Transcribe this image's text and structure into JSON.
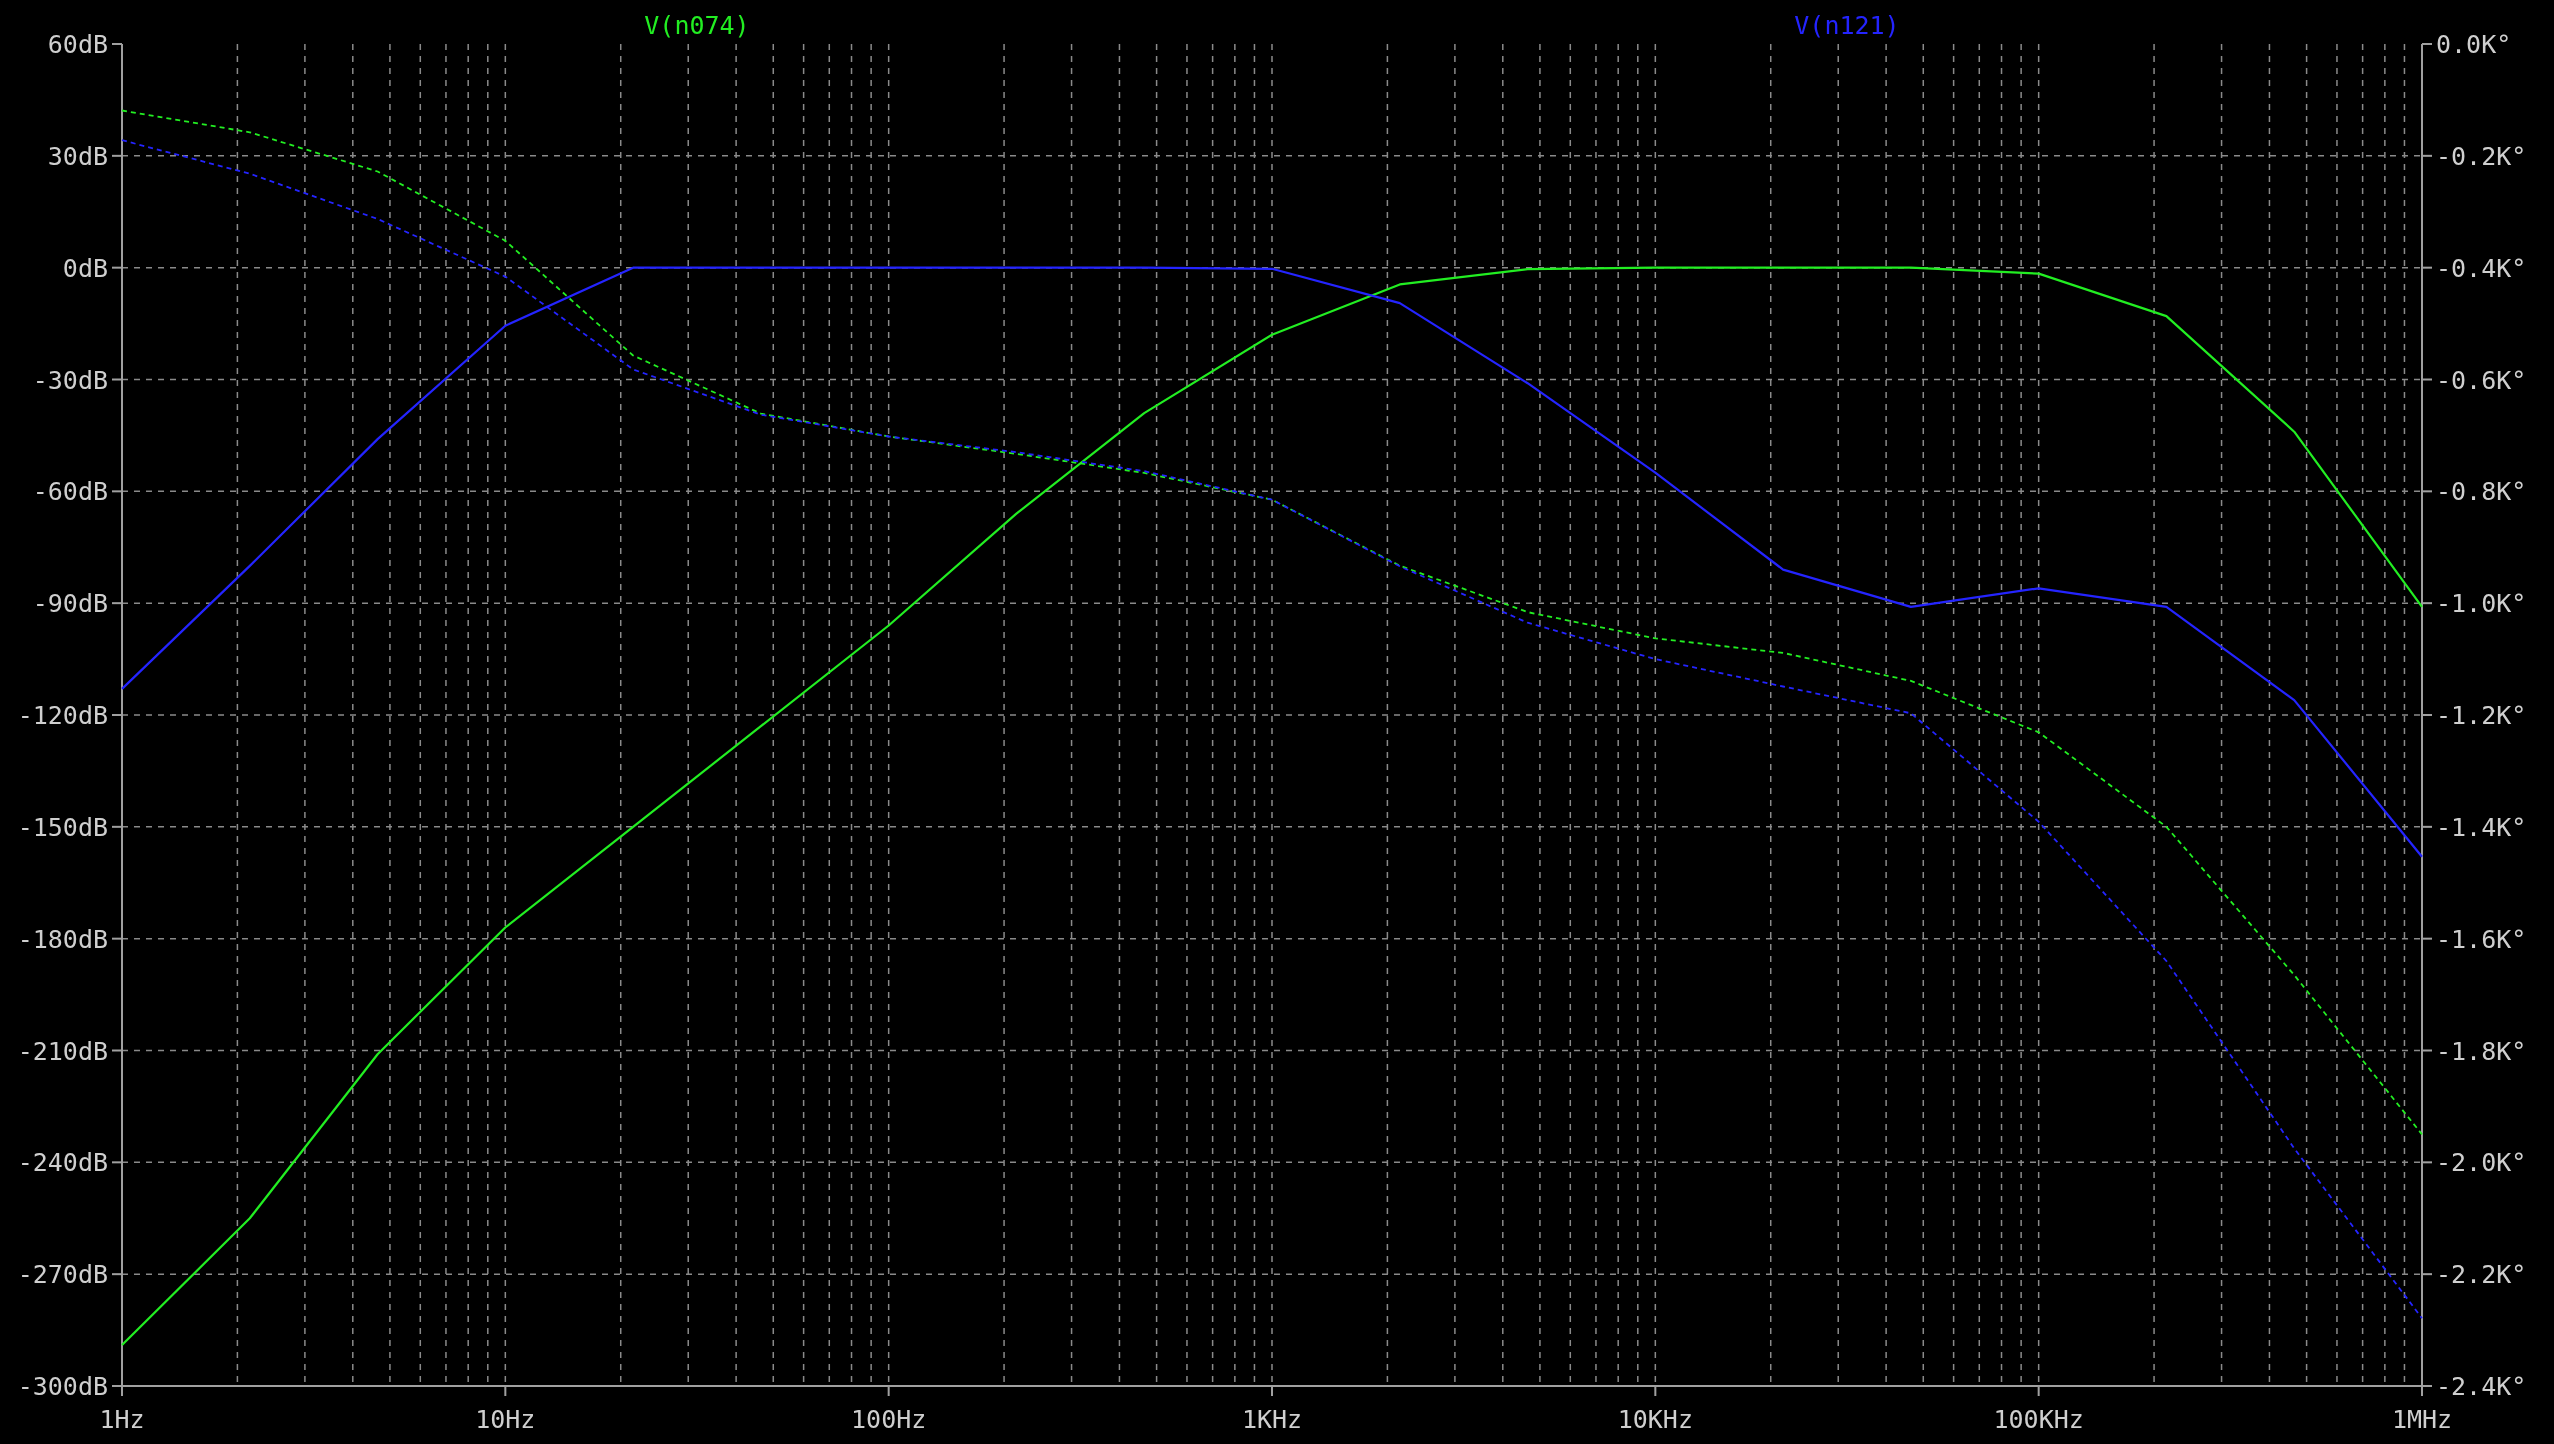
{
  "plot": {
    "magnitude_chart": {
      "chart_data": {
        "type": "line",
        "categories": [
          "1Hz",
          null,
          null,
          "10Hz",
          null,
          null,
          "100Hz",
          null,
          null,
          "1KHz",
          null,
          null,
          "10KHz",
          null,
          null,
          "100KHz",
          null,
          null,
          "1MHz"
        ],
        "series": [
          {
            "name": "V(n074)",
            "color": "#22ee22",
            "line_style": "solid",
            "values": [
              -289,
              -255,
              -211,
              -177,
              -150,
              -123,
              -96,
              -66,
              -39,
              -18,
              -4.5,
              -0.4,
              0,
              0,
              0,
              -1.6,
              -13,
              -44,
              -91
            ]
          },
          {
            "name": "V(n121)",
            "color": "#2424ff",
            "line_style": "solid",
            "values": [
              -113,
              -80,
              -46,
              -15.6,
              0,
              0,
              0,
              0,
              0,
              -0.3,
              -9.5,
              -31,
              -55,
              -81,
              -91,
              -86,
              -91,
              -116,
              -158
            ]
          }
        ],
        "ylim": [
          -300,
          60
        ],
        "grid": true,
        "yticks": [
          {
            "value": 60,
            "label": "60dB"
          },
          {
            "value": 30,
            "label": "30dB"
          },
          {
            "value": 0,
            "label": "0dB"
          },
          {
            "value": -30,
            "label": "-30dB"
          },
          {
            "value": -60,
            "label": "-60dB"
          },
          {
            "value": -90,
            "label": "-90dB"
          },
          {
            "value": -120,
            "label": "-120dB"
          },
          {
            "value": -150,
            "label": "-150dB"
          },
          {
            "value": -180,
            "label": "-180dB"
          },
          {
            "value": -210,
            "label": "-210dB"
          },
          {
            "value": -240,
            "label": "-240dB"
          },
          {
            "value": -270,
            "label": "-270dB"
          },
          {
            "value": -300,
            "label": "-300dB"
          }
        ]
      }
    },
    "phase_chart": {
      "chart_data": {
        "type": "line",
        "categories": [
          null,
          null,
          null,
          null,
          null,
          null,
          null,
          null,
          null,
          null,
          null,
          null,
          null,
          null,
          null,
          null,
          null,
          null,
          null
        ],
        "series": [
          {
            "color": "#22ee22",
            "line_style": "dashed",
            "values": [
              -0.119,
              -0.158,
              -0.228,
              -0.352,
              -0.557,
              -0.661,
              -0.702,
              -0.733,
              -0.767,
              -0.815,
              -0.933,
              -1.016,
              -1.063,
              -1.089,
              -1.139,
              -1.231,
              -1.4,
              -1.665,
              -1.95
            ]
          },
          {
            "color": "#2424ff",
            "line_style": "dashed",
            "values": [
              -0.172,
              -0.232,
              -0.313,
              -0.416,
              -0.582,
              -0.663,
              -0.702,
              -0.73,
              -0.764,
              -0.815,
              -0.934,
              -1.035,
              -1.1,
              -1.149,
              -1.197,
              -1.391,
              -1.64,
              -1.975,
              -2.279
            ]
          }
        ],
        "ylim": [
          -2.4,
          0
        ],
        "yticks": [
          {
            "value": 0,
            "label": "0.0K°"
          },
          {
            "value": -0.2,
            "label": "-0.2K°"
          },
          {
            "value": -0.4,
            "label": "-0.4K°"
          },
          {
            "value": -0.6,
            "label": "-0.6K°"
          },
          {
            "value": -0.8,
            "label": "-0.8K°"
          },
          {
            "value": -1,
            "label": "-1.0K°"
          },
          {
            "value": -1.2,
            "label": "-1.2K°"
          },
          {
            "value": -1.4,
            "label": "-1.4K°"
          },
          {
            "value": -1.6,
            "label": "-1.6K°"
          },
          {
            "value": -1.8,
            "label": "-1.8K°"
          },
          {
            "value": -2,
            "label": "-2.0K°"
          },
          {
            "value": -2.2,
            "label": "-2.2K°"
          },
          {
            "value": -2.4,
            "label": "-2.4K°"
          }
        ]
      }
    }
  }
}
